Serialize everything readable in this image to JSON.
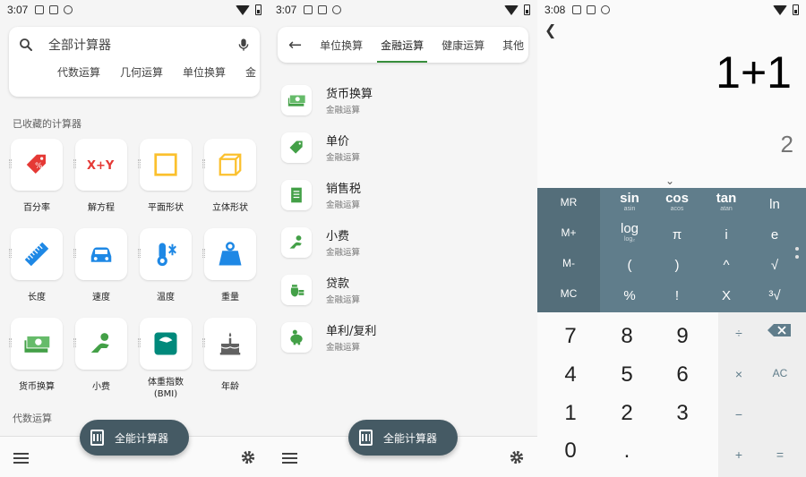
{
  "screen1": {
    "status": {
      "time": "3:07"
    },
    "search": {
      "text": "全部计算器",
      "icon": "search-icon",
      "mic_icon": "mic-icon"
    },
    "chips": [
      "代数运算",
      "几何运算",
      "单位换算",
      "金"
    ],
    "favorites_label": "已收藏的计算器",
    "tiles": [
      {
        "label": "百分率",
        "icon": "percent-tag-icon",
        "color": "#e53935"
      },
      {
        "label": "解方程",
        "icon": "equation-icon",
        "color": "#e53935"
      },
      {
        "label": "平面形状",
        "icon": "square-icon",
        "color": "#fbc02d"
      },
      {
        "label": "立体形状",
        "icon": "cube-icon",
        "color": "#fbc02d"
      },
      {
        "label": "长度",
        "icon": "ruler-icon",
        "color": "#1e88e5"
      },
      {
        "label": "速度",
        "icon": "car-icon",
        "color": "#1e88e5"
      },
      {
        "label": "温度",
        "icon": "thermometer-icon",
        "color": "#1e88e5"
      },
      {
        "label": "重量",
        "icon": "weight-icon",
        "color": "#1e88e5"
      },
      {
        "label": "货币换算",
        "icon": "money-icon",
        "color": "#43a047"
      },
      {
        "label": "小费",
        "icon": "tip-hand-icon",
        "color": "#43a047"
      },
      {
        "label": "体重指数\n(BMI)",
        "icon": "scale-icon",
        "color": "#00897b"
      },
      {
        "label": "年龄",
        "icon": "cake-icon",
        "color": "#616161"
      }
    ],
    "algebra_label": "代数运算",
    "fab_label": "全能计算器"
  },
  "screen2": {
    "status": {
      "time": "3:07"
    },
    "tabs": [
      "单位换算",
      "金融运算",
      "健康运算",
      "其他"
    ],
    "active_tab": 1,
    "items": [
      {
        "title": "货币换算",
        "subtitle": "金融运算",
        "icon": "money-icon"
      },
      {
        "title": "单价",
        "subtitle": "金融运算",
        "icon": "price-tag-icon"
      },
      {
        "title": "销售税",
        "subtitle": "金融运算",
        "icon": "receipt-icon"
      },
      {
        "title": "小费",
        "subtitle": "金融运算",
        "icon": "tip-hand-icon"
      },
      {
        "title": "贷款",
        "subtitle": "金融运算",
        "icon": "loan-icon"
      },
      {
        "title": "单利/复利",
        "subtitle": "金融运算",
        "icon": "piggy-bank-icon"
      }
    ],
    "fab_label": "全能计算器",
    "accent": "#43a047"
  },
  "screen3": {
    "status": {
      "time": "3:08"
    },
    "expression": "1+1",
    "result": "2",
    "memory_keys": [
      "MR",
      "M+",
      "M-",
      "MC"
    ],
    "sci_keys": [
      {
        "main": "sin",
        "sub": "asin"
      },
      {
        "main": "cos",
        "sub": "acos"
      },
      {
        "main": "tan",
        "sub": "atan"
      },
      {
        "main": "ln",
        "sub": ""
      },
      {
        "main": "log",
        "sub": "log₂"
      },
      {
        "main": "π",
        "sub": ""
      },
      {
        "main": "i",
        "sub": ""
      },
      {
        "main": "e",
        "sub": ""
      },
      {
        "main": "(",
        "sub": ""
      },
      {
        "main": ")",
        "sub": ""
      },
      {
        "main": "^",
        "sub": ""
      },
      {
        "main": "√",
        "sub": ""
      },
      {
        "main": "%",
        "sub": ""
      },
      {
        "main": "!",
        "sub": ""
      },
      {
        "main": "X",
        "sub": ""
      },
      {
        "main": "³√",
        "sub": ""
      }
    ],
    "digits": [
      "7",
      "8",
      "9",
      "4",
      "5",
      "6",
      "1",
      "2",
      "3",
      "0",
      "."
    ],
    "ops": [
      "÷",
      "×",
      "AC",
      "−",
      "+",
      "="
    ]
  }
}
